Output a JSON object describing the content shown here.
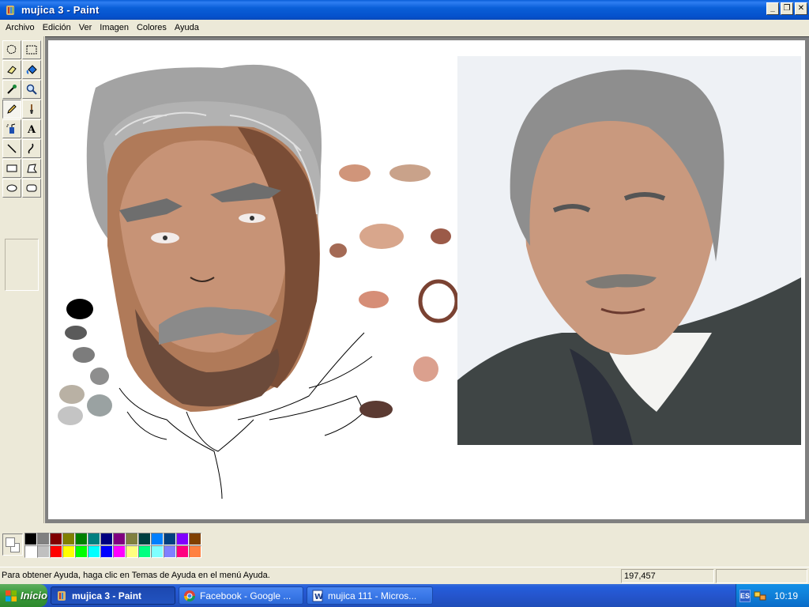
{
  "window": {
    "title": "mujica 3 - Paint"
  },
  "menu": [
    "Archivo",
    "Edición",
    "Ver",
    "Imagen",
    "Colores",
    "Ayuda"
  ],
  "tools": [
    {
      "name": "free-select-icon"
    },
    {
      "name": "rect-select-icon"
    },
    {
      "name": "eraser-icon"
    },
    {
      "name": "fill-icon"
    },
    {
      "name": "eyedropper-icon"
    },
    {
      "name": "magnifier-icon"
    },
    {
      "name": "pencil-icon"
    },
    {
      "name": "brush-icon"
    },
    {
      "name": "airbrush-icon"
    },
    {
      "name": "text-icon"
    },
    {
      "name": "line-icon"
    },
    {
      "name": "curve-icon"
    },
    {
      "name": "rectangle-icon"
    },
    {
      "name": "polygon-icon"
    },
    {
      "name": "ellipse-icon"
    },
    {
      "name": "rounded-rect-icon"
    }
  ],
  "active_tool": "pencil-icon",
  "palette": {
    "top": [
      "#000000",
      "#808080",
      "#800000",
      "#808000",
      "#008000",
      "#008080",
      "#000080",
      "#800080",
      "#808040",
      "#004040",
      "#0080ff",
      "#004080",
      "#8000ff",
      "#804000"
    ],
    "bottom": [
      "#ffffff",
      "#c0c0c0",
      "#ff0000",
      "#ffff00",
      "#00ff00",
      "#00ffff",
      "#0000ff",
      "#ff00ff",
      "#ffff80",
      "#00ff80",
      "#80ffff",
      "#8080ff",
      "#ff0080",
      "#ff8040"
    ]
  },
  "status": {
    "help": "Para obtener Ayuda, haga clic en Temas de Ayuda en el menú Ayuda.",
    "coords": "197,457"
  },
  "taskbar": {
    "start": "Inicio",
    "tasks": [
      "mujica 3 - Paint",
      "Facebook - Google ...",
      "mujica 111 - Micros..."
    ],
    "lang": "ES",
    "clock": "10:19"
  }
}
